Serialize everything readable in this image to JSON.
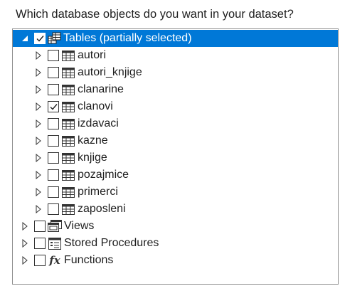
{
  "dialog": {
    "question": "Which database objects do you want in your dataset?"
  },
  "tree": {
    "tables": {
      "label": "Tables (partially selected)",
      "expanded": true,
      "state": "partial",
      "children": [
        {
          "label": "autori",
          "checked": false
        },
        {
          "label": "autori_knjige",
          "checked": false
        },
        {
          "label": "clanarine",
          "checked": false
        },
        {
          "label": "clanovi",
          "checked": true
        },
        {
          "label": "izdavaci",
          "checked": false
        },
        {
          "label": "kazne",
          "checked": false
        },
        {
          "label": "knjige",
          "checked": false
        },
        {
          "label": "pozajmice",
          "checked": false
        },
        {
          "label": "primerci",
          "checked": false
        },
        {
          "label": "zaposleni",
          "checked": false
        }
      ]
    },
    "views": {
      "label": "Views",
      "checked": false
    },
    "stored_procedures": {
      "label": "Stored Procedures",
      "checked": false
    },
    "functions": {
      "label": "Functions",
      "checked": false
    }
  },
  "colors": {
    "selection": "#0078d7",
    "border": "#8f8f8f"
  }
}
